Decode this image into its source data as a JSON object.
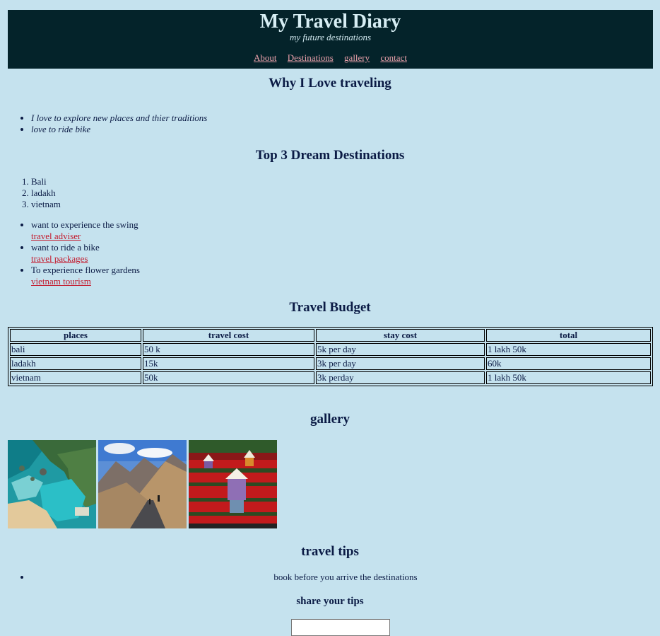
{
  "header": {
    "title": "My Travel Diary",
    "subtitle": "my future destinations",
    "nav": [
      "About",
      "Destinations",
      "gallery",
      "contact"
    ]
  },
  "why_section": {
    "heading": "Why I Love traveling",
    "items": [
      "I love to explore new places and thier traditions",
      "love to ride bike"
    ]
  },
  "destinations_section": {
    "heading": "Top 3 Dream Destinations",
    "ordered": [
      "Bali",
      "ladakh",
      "vietnam"
    ],
    "reasons": [
      {
        "text": "want to experience the swing",
        "link": "travel adviser"
      },
      {
        "text": "want to ride a bike",
        "link": "travel packages"
      },
      {
        "text": "To experience flower gardens",
        "link": "vietnam tourism"
      }
    ]
  },
  "budget_section": {
    "heading": "Travel Budget",
    "columns": [
      "places",
      "travel cost",
      "stay cost",
      "total"
    ],
    "rows": [
      [
        "bali",
        "50 k",
        "5k per day",
        "1 lakh 50k"
      ],
      [
        "ladakh",
        "15k",
        "3k per day",
        "60k"
      ],
      [
        "vietnam",
        "50k",
        "3k perday",
        "1 lakh 50k"
      ]
    ]
  },
  "gallery_section": {
    "heading": "gallery"
  },
  "tips_section": {
    "heading": "travel tips",
    "items": [
      "book before you arrive the destinations"
    ],
    "share_heading": "share your tips",
    "input_value": ""
  },
  "colors": {
    "background": "#c5e2ee",
    "header_bg": "#04232a",
    "nav_link": "#e9a0aa",
    "link": "#c4182b",
    "text": "#0b1b45"
  }
}
